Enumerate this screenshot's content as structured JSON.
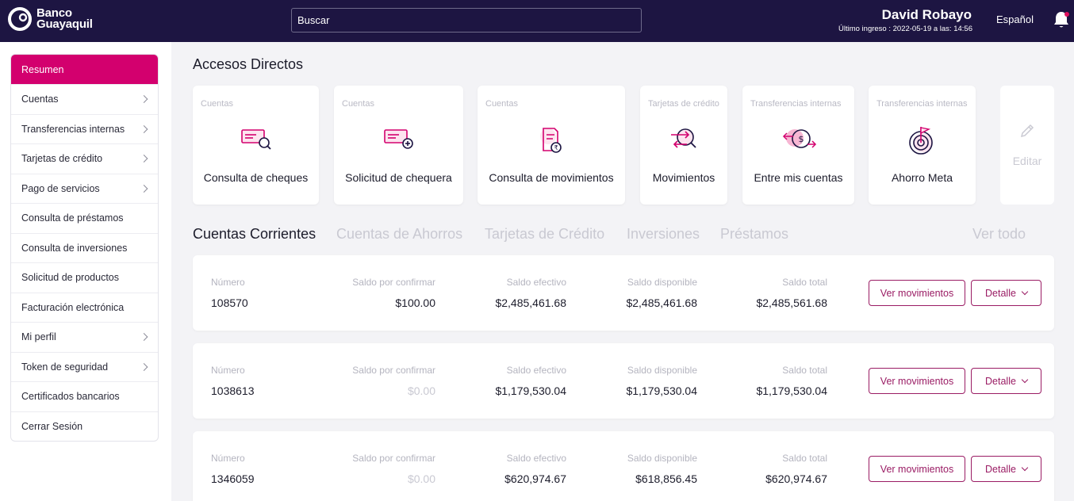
{
  "brand": {
    "line1": "Banco",
    "line2": "Guayaquil"
  },
  "search": {
    "placeholder": "Buscar"
  },
  "user": {
    "name": "David Robayo",
    "last_login": "Último ingreso : 2022-05-19 a las: 14:56"
  },
  "language": "Español",
  "colors": {
    "topbar": "#1d1542",
    "accent": "#d3006e",
    "button": "#9a1c64"
  },
  "sidebar": {
    "items": [
      {
        "label": "Resumen",
        "active": true,
        "has_chevron": false
      },
      {
        "label": "Cuentas",
        "has_chevron": true
      },
      {
        "label": "Transferencias internas",
        "has_chevron": true
      },
      {
        "label": "Tarjetas de crédito",
        "has_chevron": true
      },
      {
        "label": "Pago de servicios",
        "has_chevron": true
      },
      {
        "label": "Consulta de préstamos",
        "has_chevron": false
      },
      {
        "label": "Consulta de inversiones",
        "has_chevron": false
      },
      {
        "label": "Solicitud de productos",
        "has_chevron": false
      },
      {
        "label": "Facturación electrónica",
        "has_chevron": false
      },
      {
        "label": "Mi perfil",
        "has_chevron": true
      },
      {
        "label": "Token de seguridad",
        "has_chevron": true
      },
      {
        "label": "Certificados bancarios",
        "has_chevron": false
      },
      {
        "label": "Cerrar Sesión",
        "has_chevron": false
      }
    ]
  },
  "quick_access": {
    "title": "Accesos Directos",
    "cards": [
      {
        "category": "Cuentas",
        "label": "Consulta de cheques",
        "icon": "check-search-icon"
      },
      {
        "category": "Cuentas",
        "label": "Solicitud de chequera",
        "icon": "check-add-icon"
      },
      {
        "category": "Cuentas",
        "label": "Consulta de movimientos",
        "icon": "document-money-icon"
      },
      {
        "category": "Tarjetas de crédito",
        "label": "Movimientos",
        "icon": "transfer-search-icon"
      },
      {
        "category": "Transferencias internas",
        "label": "Entre mis cuentas",
        "icon": "dollar-exchange-icon"
      },
      {
        "category": "Transferencias internas",
        "label": "Ahorro Meta",
        "icon": "target-flag-icon"
      }
    ],
    "edit_label": "Editar"
  },
  "tabs": {
    "items": [
      "Cuentas Corrientes",
      "Cuentas de Ahorros",
      "Tarjetas de Crédito",
      "Inversiones",
      "Préstamos"
    ],
    "active": "Cuentas Corrientes",
    "view_all": "Ver todo"
  },
  "accounts": {
    "labels": {
      "number": "Número",
      "pending": "Saldo por confirmar",
      "effective": "Saldo efectivo",
      "available": "Saldo disponible",
      "total": "Saldo total"
    },
    "buttons": {
      "movements": "Ver movimientos",
      "detail": "Detalle"
    },
    "rows": [
      {
        "number": "108570",
        "pending": "$100.00",
        "effective": "$2,485,461.68",
        "available": "$2,485,461.68",
        "total": "$2,485,561.68"
      },
      {
        "number": "1038613",
        "pending": "$0.00",
        "effective": "$1,179,530.04",
        "available": "$1,179,530.04",
        "total": "$1,179,530.04"
      },
      {
        "number": "1346059",
        "pending": "$0.00",
        "effective": "$620,974.67",
        "available": "$618,856.45",
        "total": "$620,974.67"
      }
    ]
  }
}
